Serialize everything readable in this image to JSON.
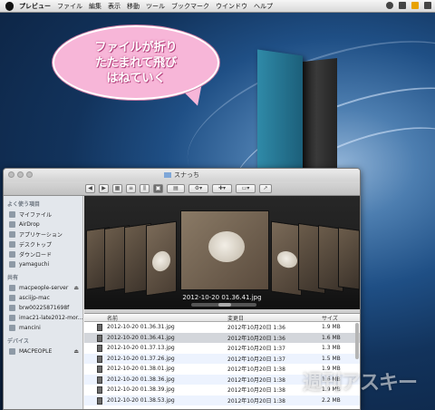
{
  "menubar": {
    "app": "プレビュー",
    "items": [
      "ファイル",
      "編集",
      "表示",
      "移動",
      "ツール",
      "ブックマーク",
      "ウインドウ",
      "ヘルプ"
    ]
  },
  "annotation": {
    "lines": [
      "ファイルが折り",
      "たたまれて飛び",
      "はねていく"
    ]
  },
  "window": {
    "title": "スナっち",
    "coverflow_caption": "2012-10-20 01.36.41.jpg"
  },
  "sidebar": {
    "favorites_header": "よく使う項目",
    "favorites": [
      {
        "label": "マイファイル",
        "icon": "files-icon"
      },
      {
        "label": "AirDrop",
        "icon": "airdrop-icon"
      },
      {
        "label": "アプリケーション",
        "icon": "applications-icon"
      },
      {
        "label": "デスクトップ",
        "icon": "desktop-icon"
      },
      {
        "label": "ダウンロード",
        "icon": "downloads-icon"
      },
      {
        "label": "yamaguchi",
        "icon": "home-icon"
      }
    ],
    "shared_header": "共有",
    "shared": [
      {
        "label": "macpeople-server",
        "eject": true
      },
      {
        "label": "asciijp-mac",
        "eject": false
      },
      {
        "label": "brw00225871698f",
        "eject": false
      },
      {
        "label": "imac21-late2012-mor...",
        "eject": false
      },
      {
        "label": "mancini",
        "eject": false
      }
    ],
    "devices_header": "デバイス",
    "devices": [
      {
        "label": "MACPEOPLE",
        "eject": true
      }
    ]
  },
  "list": {
    "headers": {
      "name": "名前",
      "date": "変更日",
      "size": "サイズ"
    },
    "rows": [
      {
        "name": "2012-10-20 01.36.31.jpg",
        "date": "2012年10月20日 1:36",
        "size": "1.9 MB"
      },
      {
        "name": "2012-10-20 01.36.41.jpg",
        "date": "2012年10月20日 1:36",
        "size": "1.6 MB",
        "selected": true
      },
      {
        "name": "2012-10-20 01.37.13.jpg",
        "date": "2012年10月20日 1:37",
        "size": "1.3 MB"
      },
      {
        "name": "2012-10-20 01.37.26.jpg",
        "date": "2012年10月20日 1:37",
        "size": "1.5 MB"
      },
      {
        "name": "2012-10-20 01.38.01.jpg",
        "date": "2012年10月20日 1:38",
        "size": "1.9 MB"
      },
      {
        "name": "2012-10-20 01.38.36.jpg",
        "date": "2012年10月20日 1:38",
        "size": "1.6 MB"
      },
      {
        "name": "2012-10-20 01.38.39.jpg",
        "date": "2012年10月20日 1:38",
        "size": "1.9 MB"
      },
      {
        "name": "2012-10-20 01.38.53.jpg",
        "date": "2012年10月20日 1:38",
        "size": "2.2 MB"
      }
    ]
  },
  "watermark": "週刊アスキー"
}
